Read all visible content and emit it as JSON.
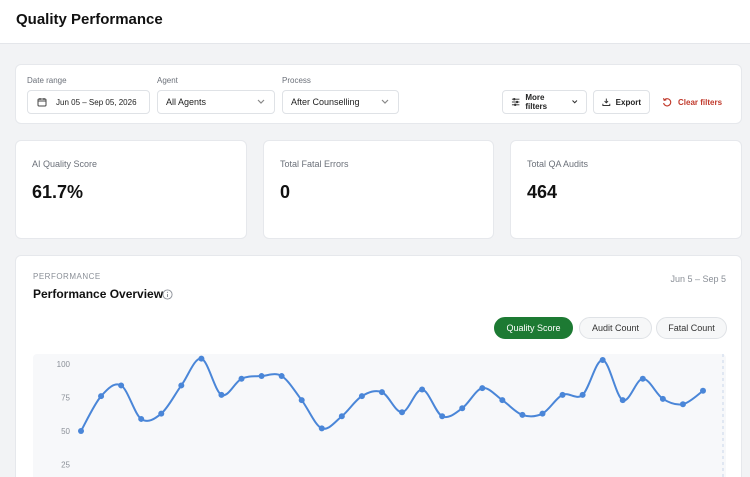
{
  "header": {
    "title": "Quality Performance"
  },
  "filters": {
    "date_label": "Date range",
    "date_value": "Jun 05 – Sep 05, 2026",
    "agent_label": "Agent",
    "agent_value": "All Agents",
    "process_label": "Process",
    "process_value": "After Counselling",
    "more_filters": "More filters",
    "export": "Export",
    "clear": "Clear filters"
  },
  "kpis": [
    {
      "label": "AI Quality Score",
      "value": "61.7%"
    },
    {
      "label": "Total Fatal Errors",
      "value": "0"
    },
    {
      "label": "Total QA Audits",
      "value": "464"
    }
  ],
  "performance": {
    "section_label": "PERFORMANCE",
    "title": "Performance Overview",
    "date_range": "Jun 5 – Sep 5",
    "tabs": [
      {
        "label": "Quality Score",
        "active": true
      },
      {
        "label": "Audit Count",
        "active": false
      },
      {
        "label": "Fatal Count",
        "active": false
      }
    ]
  },
  "colors": {
    "accent": "#1d7a33",
    "line": "#4a86d8",
    "danger": "#c0392b"
  },
  "chart_data": {
    "type": "line",
    "title": "",
    "xlabel": "",
    "ylabel": "",
    "ylim": [
      0,
      100
    ],
    "yticks": [
      100,
      75,
      50,
      25
    ],
    "grid": false,
    "series": [
      {
        "values": [
          50,
          76,
          84,
          59,
          63,
          84,
          104,
          77,
          89,
          91,
          91,
          73,
          52,
          61,
          76,
          79,
          64,
          81,
          61,
          67,
          82,
          73,
          62,
          63,
          77,
          77,
          103,
          73,
          89,
          74,
          70,
          80
        ]
      }
    ]
  }
}
